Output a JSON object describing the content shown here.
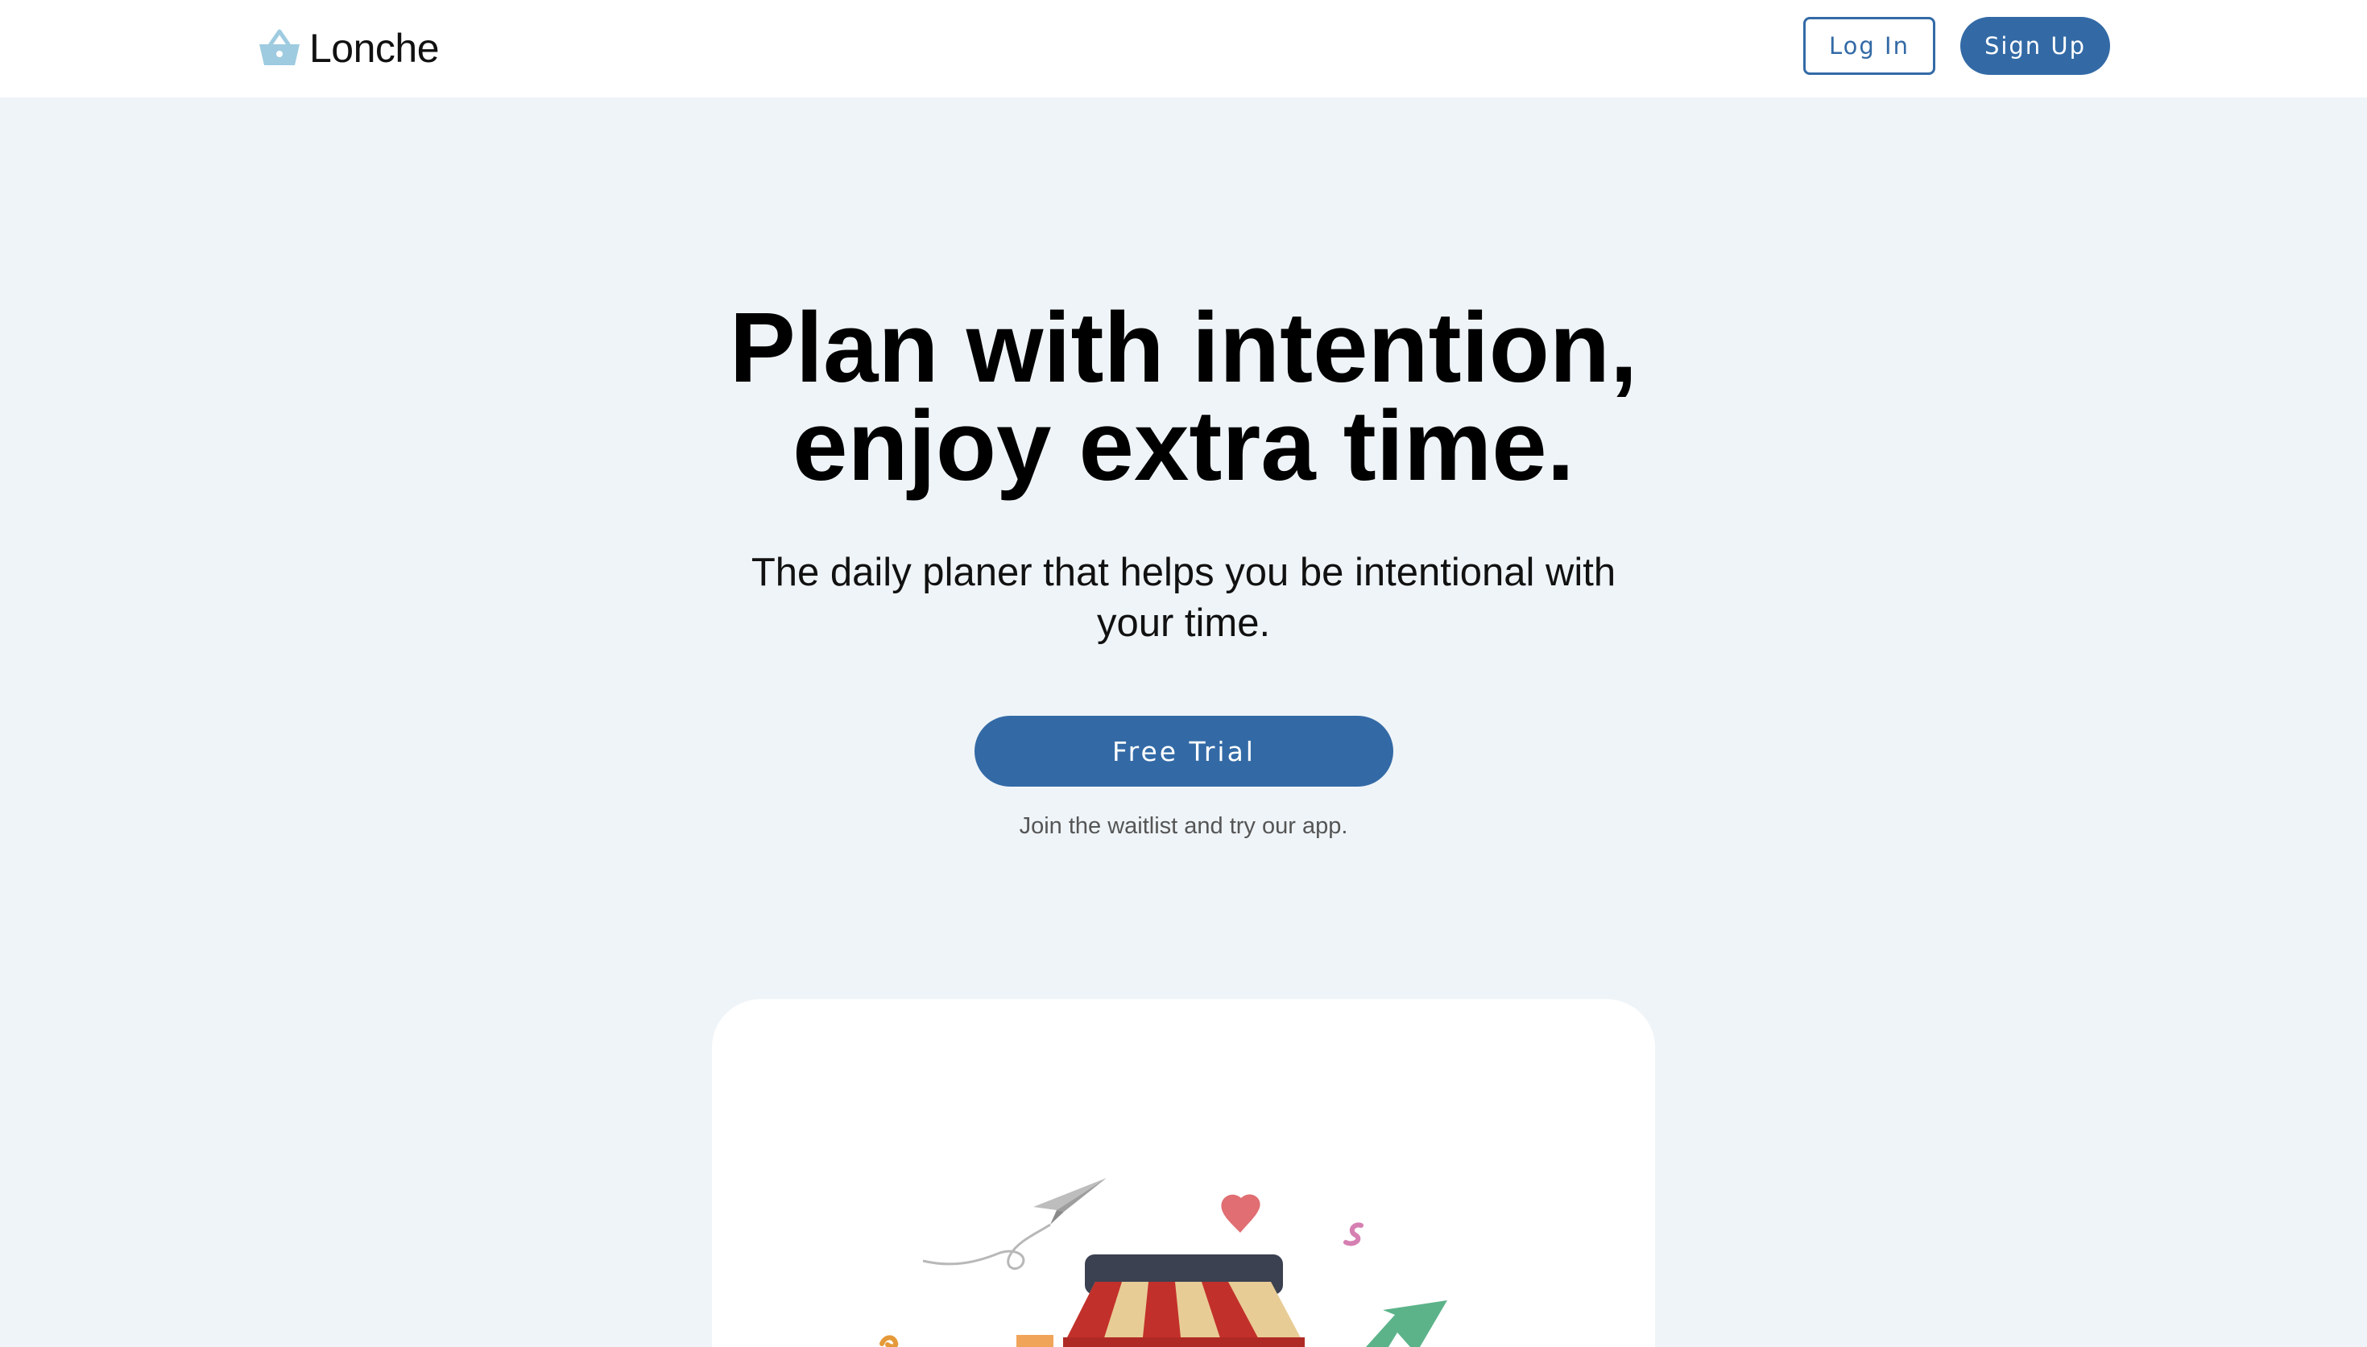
{
  "navbar": {
    "brand": "Lonche",
    "brand_logo_icon": "basket-icon",
    "login_label": "Log In",
    "signup_label": "Sign Up"
  },
  "hero": {
    "title_line1": "Plan with intention,",
    "title_line2": "enjoy extra time.",
    "subtitle": "The daily planer that helps you be intentional with your time.",
    "cta_label": "Free Trial",
    "note": "Join the waitlist and try our app."
  },
  "colors": {
    "accent": "#336aa6",
    "page_background": "#eff4f8",
    "card_background": "#ffffff"
  },
  "illustration": {
    "icons": [
      "paper-plane-icon",
      "heart-icon",
      "squiggle-icon",
      "storefront-awning-icon",
      "arrow-icon"
    ]
  }
}
